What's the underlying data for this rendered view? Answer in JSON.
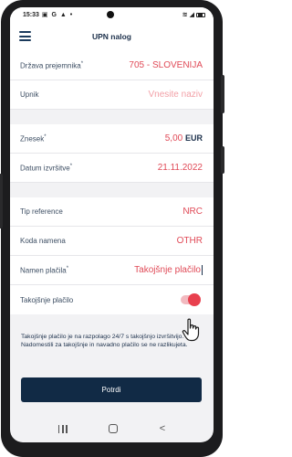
{
  "status": {
    "time": "15:33",
    "notification_icons": "▣ G ▲ •",
    "signal_text": "4G"
  },
  "header": {
    "title": "UPN nalog",
    "menu_icon": "hamburger-icon"
  },
  "form": {
    "drzava_label": "Država prejemnika",
    "drzava_value": "705 - SLOVENIJA",
    "upnik_label": "Upnik",
    "upnik_placeholder": "Vnesite naziv",
    "znesek_label": "Znesek",
    "znesek_value": "5,00",
    "znesek_currency": "EUR",
    "datum_label": "Datum izvršitve",
    "datum_value": "21.11.2022",
    "tip_label": "Tip reference",
    "tip_value": "NRC",
    "koda_label": "Koda namena",
    "koda_value": "OTHR",
    "namen_label": "Namen plačila",
    "namen_value": "Takojšnje plačilo",
    "takojsnje_label": "Takojšnje plačilo",
    "takojsnje_on": true,
    "required_marker": "*"
  },
  "info_text": "Takojšnje plačilo je na razpolago 24/7 s takojšnjo izvršitvijo. Nadomestili za takojšnje in navadno plačilo se ne razlikujeta.",
  "actions": {
    "confirm_label": "Potrdi"
  },
  "colors": {
    "accent": "#e04a57",
    "primary_dark": "#112a45",
    "background": "#f2f2f4"
  }
}
